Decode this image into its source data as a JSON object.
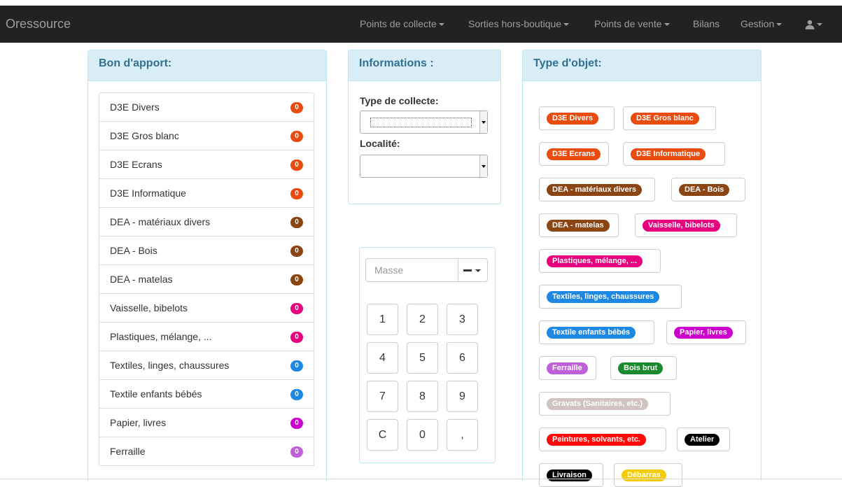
{
  "navbar": {
    "brand": "Oressource",
    "items": [
      {
        "label": "Points de collecte",
        "caret": true
      },
      {
        "label": "Sorties hors-boutique",
        "caret": true
      },
      {
        "label": "Points de vente",
        "caret": true
      },
      {
        "label": "Bilans",
        "caret": false
      },
      {
        "label": "Gestion",
        "caret": true
      }
    ],
    "user_icon": "user-icon"
  },
  "bon_apport": {
    "title": "Bon d'apport:",
    "items": [
      {
        "label": "D3E Divers",
        "count": "0",
        "color": "#e84c0e"
      },
      {
        "label": "D3E Gros blanc",
        "count": "0",
        "color": "#e84c0e"
      },
      {
        "label": "D3E Ecrans",
        "count": "0",
        "color": "#e84c0e"
      },
      {
        "label": "D3E Informatique",
        "count": "0",
        "color": "#e84c0e"
      },
      {
        "label": "DEA - matériaux divers",
        "count": "0",
        "color": "#8b4513"
      },
      {
        "label": "DEA - Bois",
        "count": "0",
        "color": "#8b4513"
      },
      {
        "label": "DEA - matelas",
        "count": "0",
        "color": "#8b4513"
      },
      {
        "label": "Vaisselle, bibelots",
        "count": "0",
        "color": "#e6007e"
      },
      {
        "label": "Plastiques, mélange, ...",
        "count": "0",
        "color": "#e6007e"
      },
      {
        "label": "Textiles, linges, chaussures",
        "count": "0",
        "color": "#1e88e5"
      },
      {
        "label": "Textile enfants bébés",
        "count": "0",
        "color": "#1e88e5"
      },
      {
        "label": "Papier, livres",
        "count": "0",
        "color": "#cc00cc"
      },
      {
        "label": "Ferraille",
        "count": "0",
        "color": "#c060d8"
      }
    ]
  },
  "informations": {
    "title": "Informations :",
    "type_collecte_label": "Type de collecte:",
    "localite_label": "Localité:",
    "type_collecte_value": "",
    "localite_value": ""
  },
  "keypad": {
    "masse_placeholder": "Masse",
    "keys": [
      "1",
      "2",
      "3",
      "4",
      "5",
      "6",
      "7",
      "8",
      "9",
      "C",
      "0",
      ","
    ]
  },
  "type_objet": {
    "title": "Type d'objet:",
    "items": [
      {
        "label": "D3E Divers",
        "color": "#e84c0e"
      },
      {
        "label": "D3E Gros blanc",
        "color": "#e84c0e"
      },
      {
        "label": "D3E Ecrans",
        "color": "#e84c0e"
      },
      {
        "label": "D3E Informatique",
        "color": "#e84c0e"
      },
      {
        "label": "DEA - matériaux divers",
        "color": "#8b4513"
      },
      {
        "label": "DEA - Bois",
        "color": "#8b4513"
      },
      {
        "label": "DEA - matelas",
        "color": "#8b4513"
      },
      {
        "label": "Vaisselle, bibelots",
        "color": "#e6007e"
      },
      {
        "label": "Plastiques, mélange, ...",
        "color": "#e6007e"
      },
      {
        "label": "Textiles, linges, chaussures",
        "color": "#1e88e5"
      },
      {
        "label": "Textile enfants bébés",
        "color": "#1e88e5"
      },
      {
        "label": "Papier, livres",
        "color": "#cc00cc"
      },
      {
        "label": "Ferraille",
        "color": "#c060d8"
      },
      {
        "label": "Bois brut",
        "color": "#1a8a2e"
      },
      {
        "label": "Gravats (Sanitaires, etc.)",
        "color": "#d2c2c2"
      },
      {
        "label": "Peintures, solvants, etc.",
        "color": "#ff0a0a"
      },
      {
        "label": "Atelier",
        "color": "#000000"
      },
      {
        "label": "Livraison",
        "color": "#000000"
      },
      {
        "label": "Débarras",
        "color": "#f5cc00"
      }
    ]
  }
}
